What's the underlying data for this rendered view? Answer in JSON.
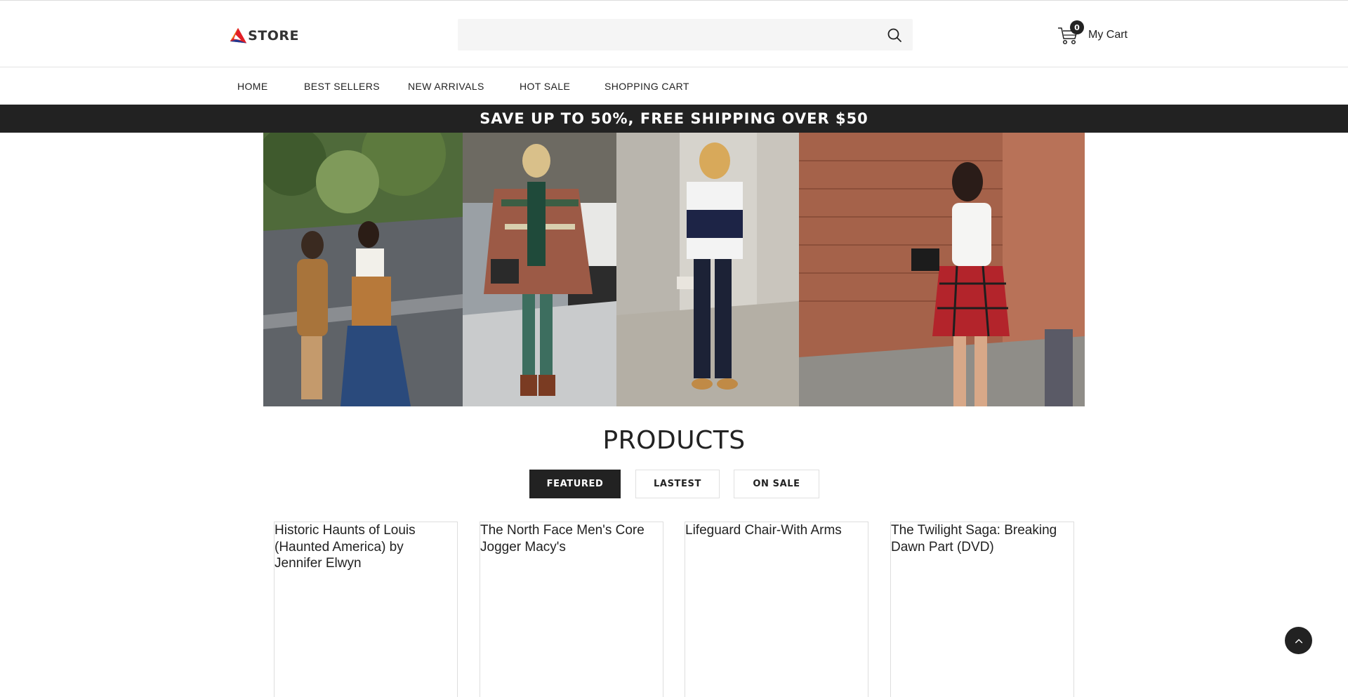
{
  "header": {
    "logo_text": "STORE",
    "search": {
      "value": "",
      "placeholder": ""
    },
    "cart": {
      "count": "0",
      "label": "My Cart"
    }
  },
  "nav": {
    "items": [
      {
        "label": "HOME"
      },
      {
        "label": "BEST SELLERS"
      },
      {
        "label": "NEW ARRIVALS"
      },
      {
        "label": "HOT SALE"
      },
      {
        "label": "SHOPPING CART"
      }
    ]
  },
  "promo": {
    "text": "SAVE UP TO 50%, FREE SHIPPING OVER $50"
  },
  "products": {
    "title": "PRODUCTS",
    "tabs": [
      {
        "label": "FEATURED",
        "active": true
      },
      {
        "label": "LASTEST",
        "active": false
      },
      {
        "label": "ON SALE",
        "active": false
      }
    ],
    "cards": [
      {
        "title": "Historic Haunts of Louis (Haunted America) by Jennifer Elwyn"
      },
      {
        "title": "The North Face Men's Core Jogger Macy's"
      },
      {
        "title": "Lifeguard Chair-With Arms"
      },
      {
        "title": "The Twilight Saga: Breaking Dawn Part (DVD)"
      }
    ]
  },
  "colors": {
    "dark": "#222222",
    "search_bg": "#f5f5f5",
    "border": "#e0e0e0"
  },
  "icons": {
    "logo": "store-logo-icon",
    "search": "search-icon",
    "cart": "cart-icon",
    "back_to_top": "chevron-up-icon"
  }
}
